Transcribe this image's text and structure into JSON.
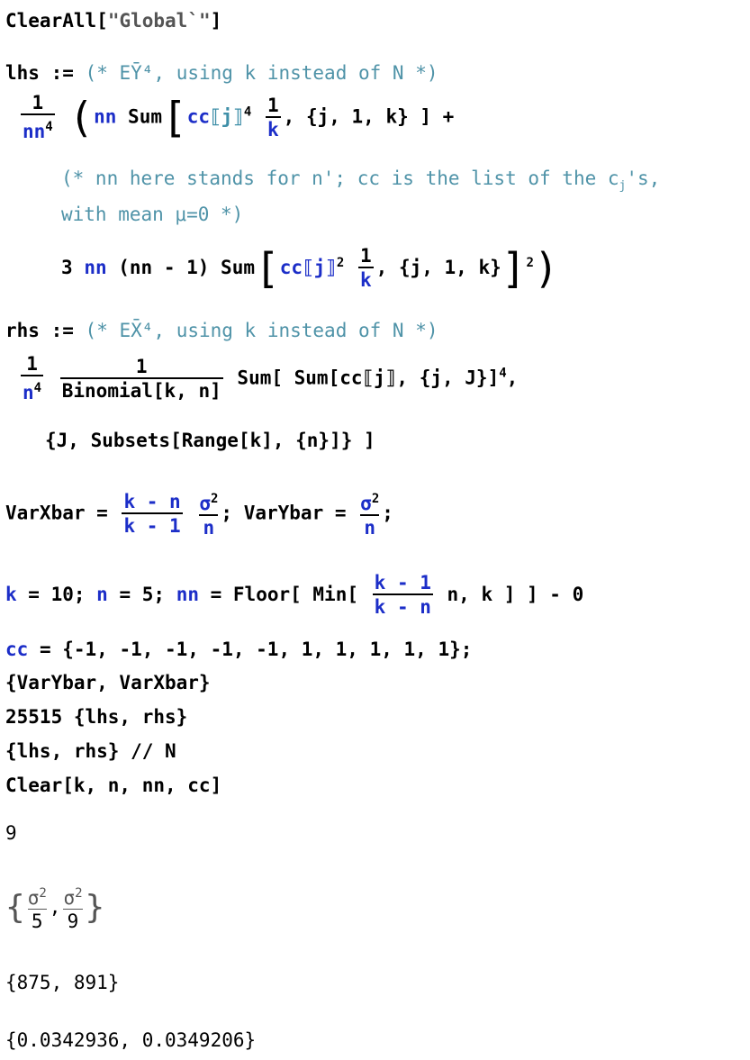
{
  "cells": {
    "clearall": {
      "fn": "ClearAll",
      "open": "[",
      "arg": "\"Global`\"",
      "close": "]"
    },
    "lhs": {
      "name": "lhs",
      "op": ":=",
      "comment": "(* EȲ⁴, using k instead of N *)",
      "frac_num": "1",
      "frac_den": "nn",
      "frac_den_exp": "4",
      "line1_a": "nn",
      "line1_b": "Sum",
      "line1_c": "cc",
      "line1_d": "⟦j⟧",
      "line1_e": "4",
      "line1_f": "1",
      "line1_g": "k",
      "line1_h": ", {j, 1, k} ] +",
      "comment2": "(* nn here stands for n'; cc is the list of the c",
      "comment2_sub": "j",
      "comment2_end": "'s,",
      "comment3": "with mean μ=0 *)",
      "line3_a": "3",
      "line3_b": "nn",
      "line3_c": "(nn - 1) Sum",
      "line3_d": "cc⟦j⟧",
      "line3_e": "2",
      "line3_f": "1",
      "line3_g": "k",
      "line3_h": ", {j, 1, k}",
      "line3_i": "2"
    },
    "rhs": {
      "name": "rhs",
      "op": ":=",
      "comment": "(* EX̄⁴, using k instead of N *)",
      "f1_num": "1",
      "f1_den": "n",
      "f1_den_exp": "4",
      "f2_num": "1",
      "f2_den": "Binomial[k, n]",
      "sum_text": "Sum[ Sum[cc⟦j⟧, {j, J}]",
      "sum_exp": "4",
      "sum_end": ",",
      "line2": "{J, Subsets[Range[k], {n}]} ]"
    },
    "vars": {
      "varx": "VarXbar =",
      "varx_num": "k - n",
      "varx_den": "k - 1",
      "sig": "σ",
      "sig_exp": "2",
      "n": "n",
      "mid": "; VarYbar =",
      "end": ";"
    },
    "assign": {
      "k": "k",
      "k_val": " = 10; ",
      "n": "n",
      "n_val": " = 5; ",
      "nn": "nn",
      "floor": " = Floor[ Min[",
      "num": "k - 1",
      "den": "k - n",
      "rest": " n, k ] ] - 0"
    },
    "cc_line": {
      "name": "cc",
      "value": " = {-1, -1, -1, -1, -1, 1, 1, 1, 1, 1};"
    },
    "line_var": "{VarYbar, VarXbar}",
    "line_scale": "25515 {lhs, rhs}",
    "line_n": "{lhs, rhs} // N",
    "line_clear": "Clear[k, n, nn, cc]",
    "outputs": {
      "out1": "9",
      "out2_num": "σ",
      "out2_exp": "2",
      "out2_den1": "5",
      "out2_den2": "9",
      "out3": "{875, 891}",
      "out4": "{0.0342936, 0.0349206}"
    }
  }
}
